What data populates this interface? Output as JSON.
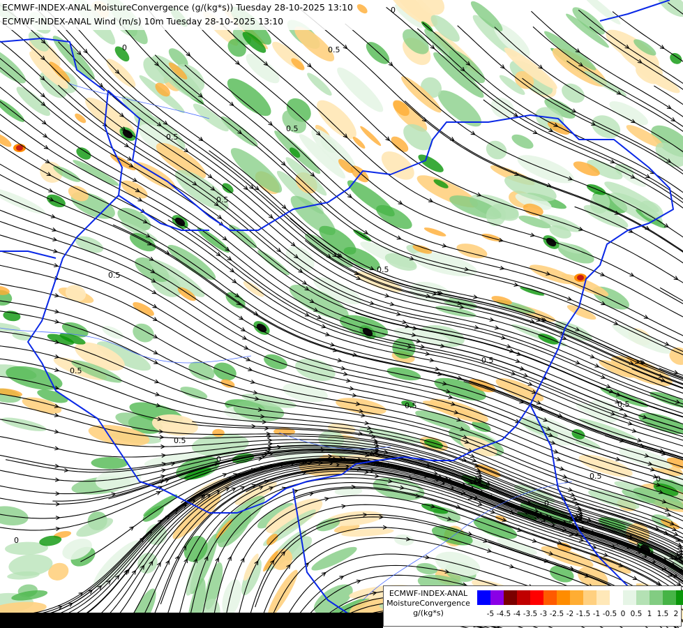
{
  "map": {
    "title_line_1": "ECMWF-INDEX-ANAL MoistureConvergence (g/(kg*s)) Tuesday 28-10-2025 13:10",
    "title_line_2": "ECMWF-INDEX-ANAL Wind (m/s) 10m Tuesday 28-10-2025 13:10",
    "contour_labels": [
      "0.5",
      "0"
    ],
    "colors": {
      "border": "#0a28e6",
      "streamline": "#000000",
      "river": "#4a6cff",
      "convergence_strong": "#0a0a0a",
      "divergence_strong": "#c81e14"
    }
  },
  "legend": {
    "title_lines": [
      "ECMWF-INDEX-ANAL",
      "MoistureConvergence",
      "g/(kg*s)"
    ],
    "swatches": [
      {
        "color": "#0000ff"
      },
      {
        "color": "#8a00e6"
      },
      {
        "color": "#7a0000"
      },
      {
        "color": "#c00000"
      },
      {
        "color": "#ff0000"
      },
      {
        "color": "#ff5a00"
      },
      {
        "color": "#ff8c00"
      },
      {
        "color": "#ffad33"
      },
      {
        "color": "#ffd080"
      },
      {
        "color": "#ffe8b8"
      },
      {
        "color": "#ffffff"
      },
      {
        "color": "#e6f5e6"
      },
      {
        "color": "#b4e1b4"
      },
      {
        "color": "#82cc82"
      },
      {
        "color": "#46b446"
      },
      {
        "color": "#0a960a"
      }
    ],
    "ticks": [
      "-5",
      "-4.5",
      "-4",
      "-3.5",
      "-3",
      "-2.5",
      "-2",
      "-1.5",
      "-1",
      "-0.5",
      "0",
      "0.5",
      "1",
      "1.5",
      "2"
    ]
  }
}
